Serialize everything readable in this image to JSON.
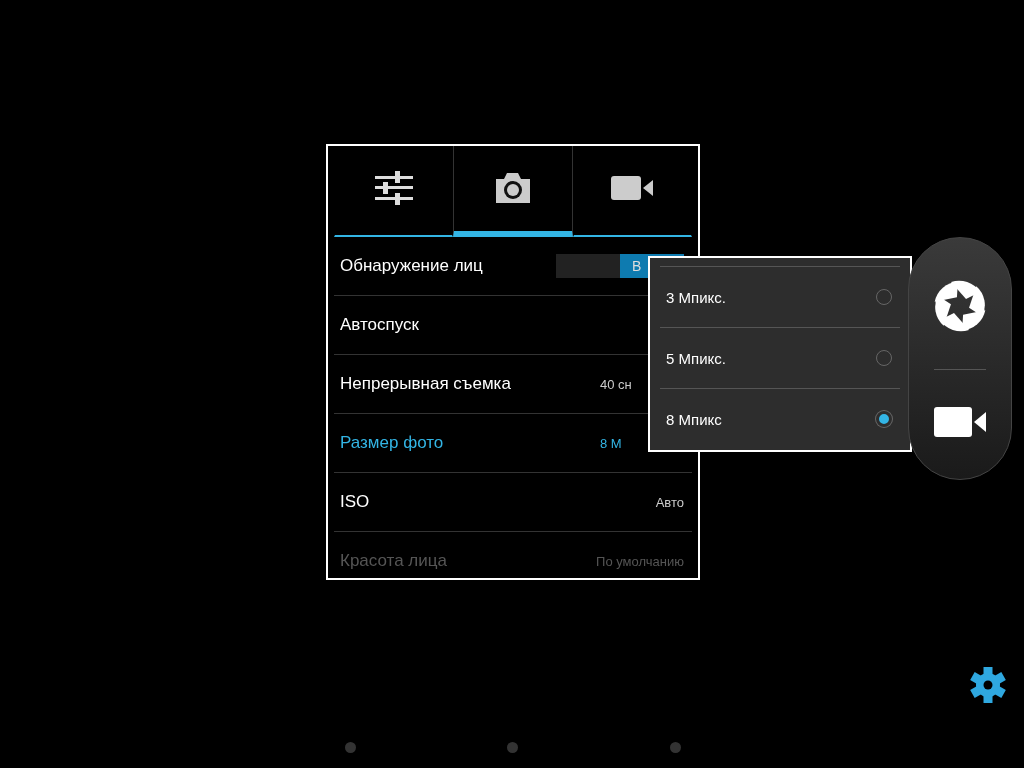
{
  "tabs": [
    {
      "kind": "sliders",
      "selected": false
    },
    {
      "kind": "camera",
      "selected": true
    },
    {
      "kind": "video",
      "selected": false
    }
  ],
  "settings": [
    {
      "kind": "toggle",
      "label": "Обнаружение лиц",
      "on": true,
      "toggle_text": "В",
      "selected": false,
      "disabled": false
    },
    {
      "kind": "value",
      "label": "Автоспуск",
      "selected": false,
      "disabled": false
    },
    {
      "kind": "value",
      "label": "Непрерывная съемка",
      "value": "40 сн",
      "cut": true,
      "selected": false,
      "disabled": false
    },
    {
      "kind": "value",
      "label": "Размер фото",
      "value": "8 М",
      "cut": true,
      "selected": true,
      "disabled": false
    },
    {
      "kind": "value",
      "label": "ISO",
      "value": "Авто",
      "cut": false,
      "selected": false,
      "disabled": false
    },
    {
      "kind": "value",
      "label": "Красота лица",
      "value": "По умолчанию",
      "cut": false,
      "selected": false,
      "disabled": true
    }
  ],
  "size_options": [
    {
      "label": "3 Мпикс.",
      "selected": false
    },
    {
      "label": "5 Мпикс.",
      "selected": false
    },
    {
      "label": "8 Мпикс",
      "selected": true
    }
  ]
}
